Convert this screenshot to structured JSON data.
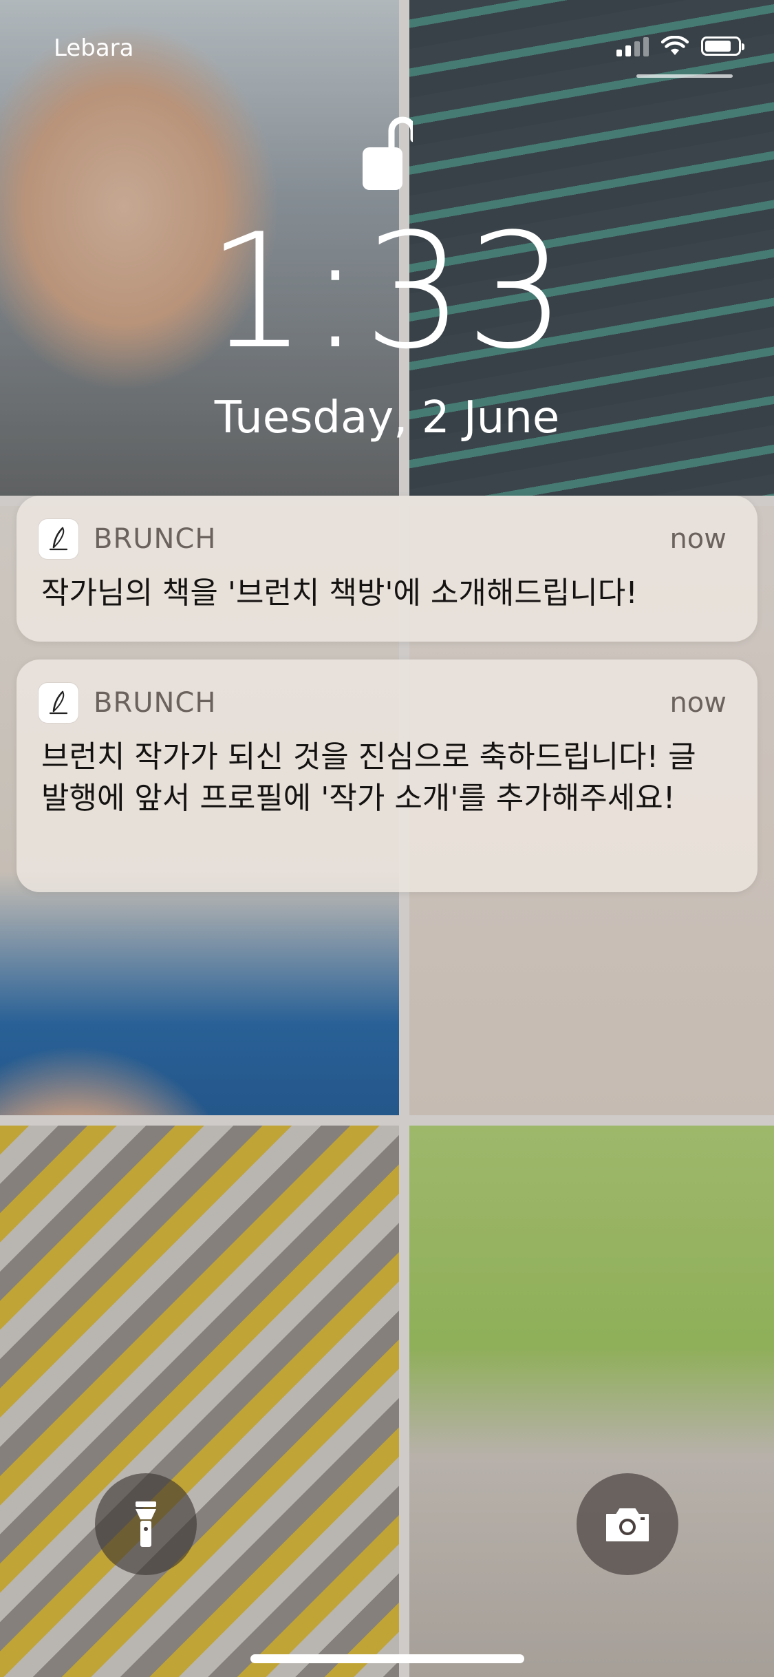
{
  "status_bar": {
    "carrier": "Lebara",
    "signal_bars": 4,
    "signal_bars_on": 2,
    "battery_level": 0.8
  },
  "lock_screen": {
    "time": "1:33",
    "date": "Tuesday, 2 June",
    "lock_icon": "unlocked-padlock-icon"
  },
  "notifications": [
    {
      "app": "BRUNCH",
      "time": "now",
      "message": "작가님의 책을 '브런치 책방'에 소개해드립니다!",
      "icon": "brunch-pen-icon"
    },
    {
      "app": "BRUNCH",
      "time": "now",
      "message": "브런치 작가가 되신 것을 진심으로 축하드립니다! 글 발행에 앞서 프로필에 '작가 소개'를 추가해주세요!",
      "icon": "brunch-pen-icon"
    }
  ],
  "quick_actions": {
    "left": "flashlight-icon",
    "right": "camera-icon"
  },
  "colors": {
    "text_primary": "#151312",
    "text_secondary": "#6b625d",
    "notification_bg": "#eee6e0"
  }
}
